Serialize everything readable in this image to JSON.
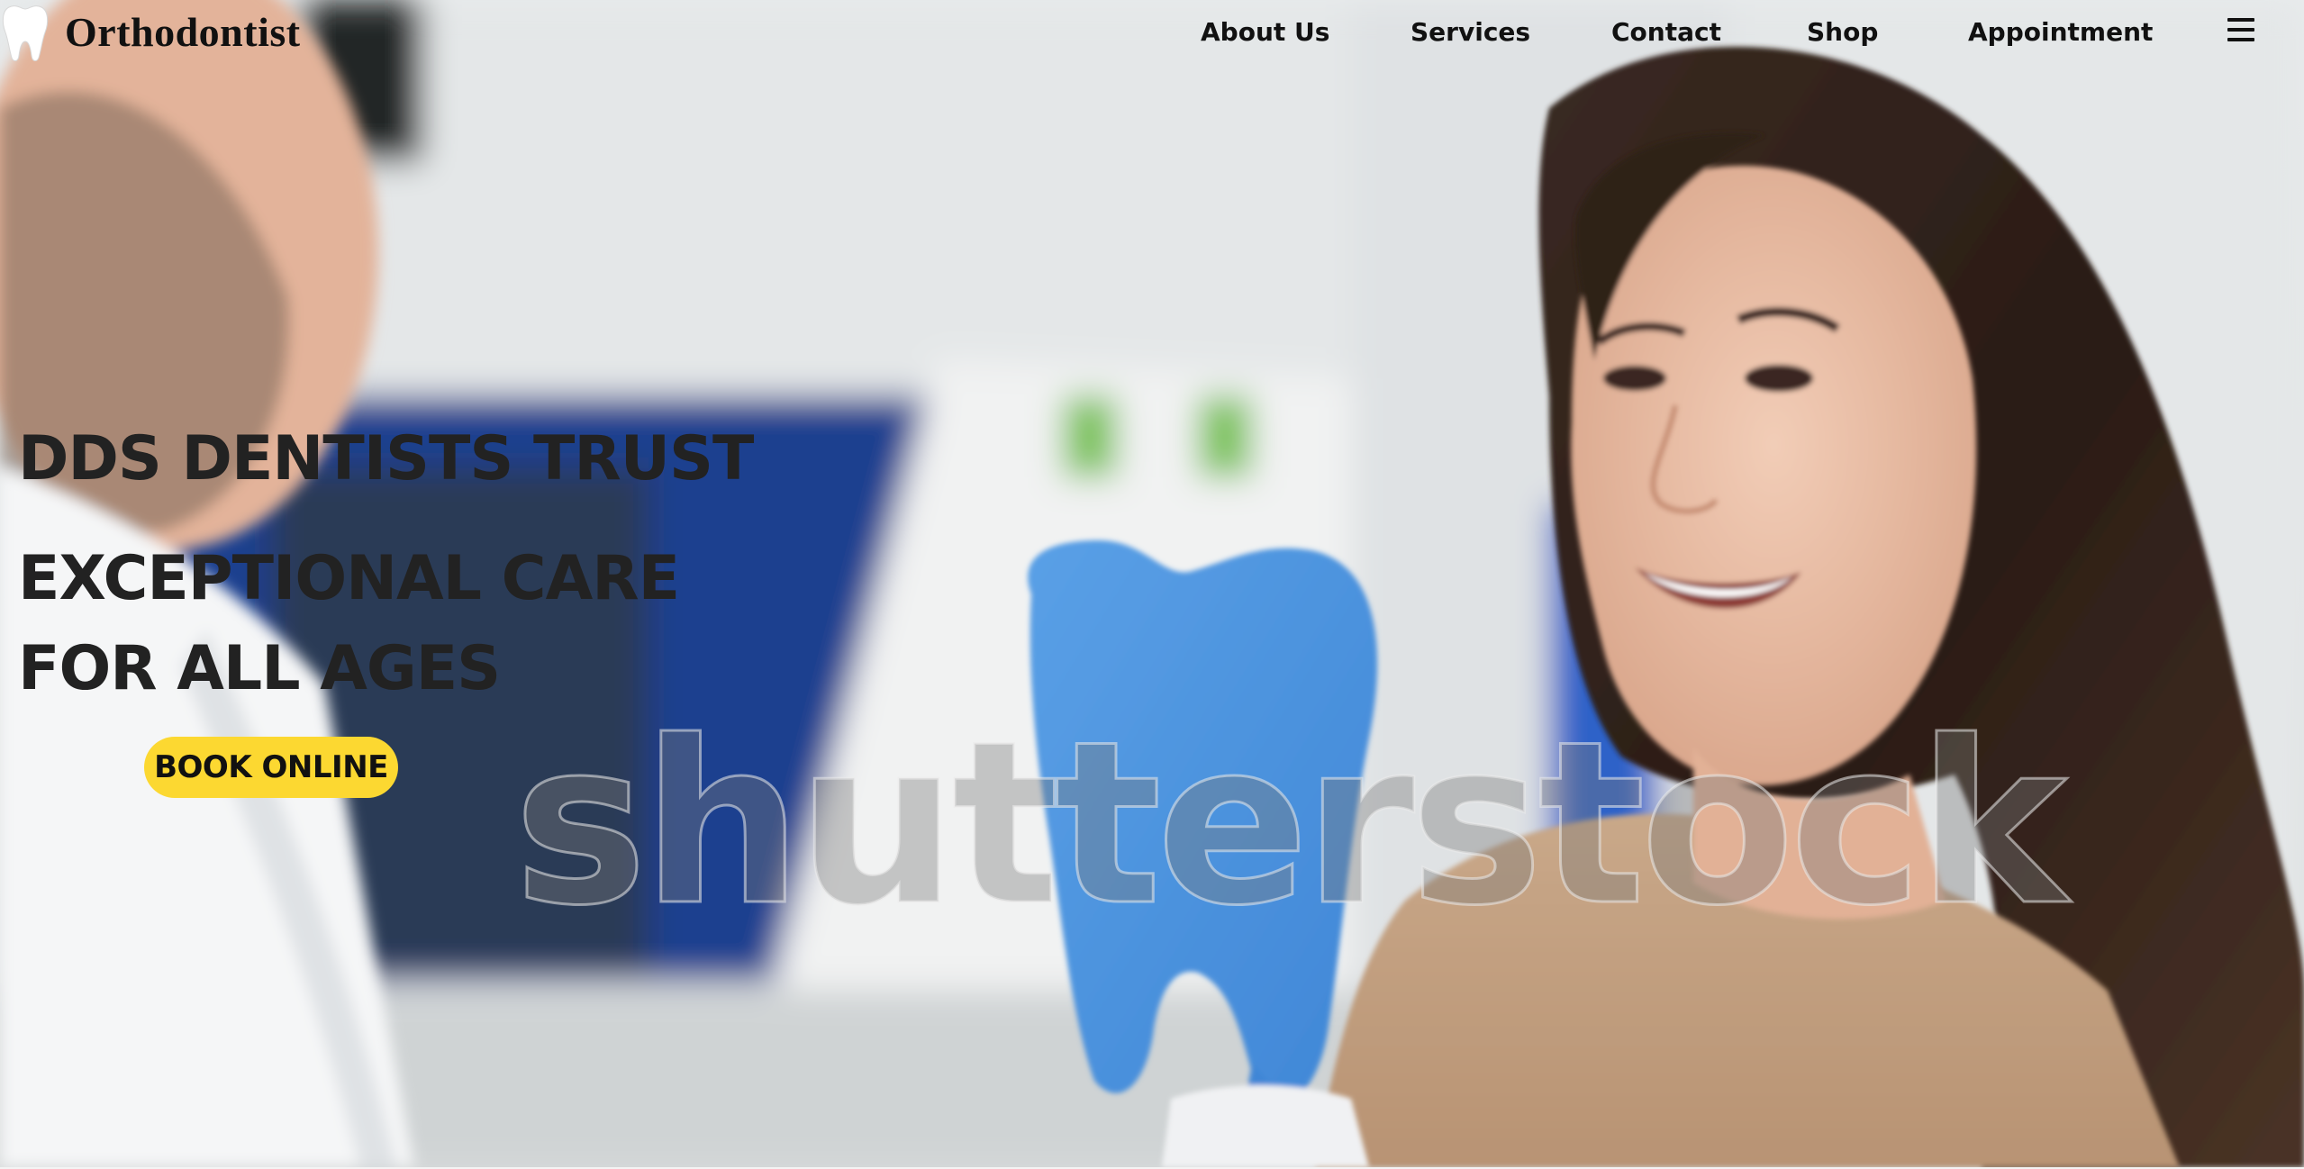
{
  "brand": {
    "name": "Orthodontist",
    "logo_icon": "tooth-icon"
  },
  "nav": {
    "items": [
      {
        "label": "About Us"
      },
      {
        "label": "Services"
      },
      {
        "label": "Contact"
      },
      {
        "label": "Shop"
      },
      {
        "label": "Appointment"
      }
    ],
    "menu_icon": "hamburger-menu-icon"
  },
  "hero": {
    "tagline": "DDS DENTISTS TRUST",
    "headline_line1": "EXCEPTIONAL CARE",
    "headline_line2": "FOR ALL AGES",
    "cta_label": "BOOK ONLINE",
    "watermark": "shutterstock"
  },
  "colors": {
    "cta_background": "#fcd831",
    "heading_text": "#222222",
    "nav_text": "#111111"
  }
}
